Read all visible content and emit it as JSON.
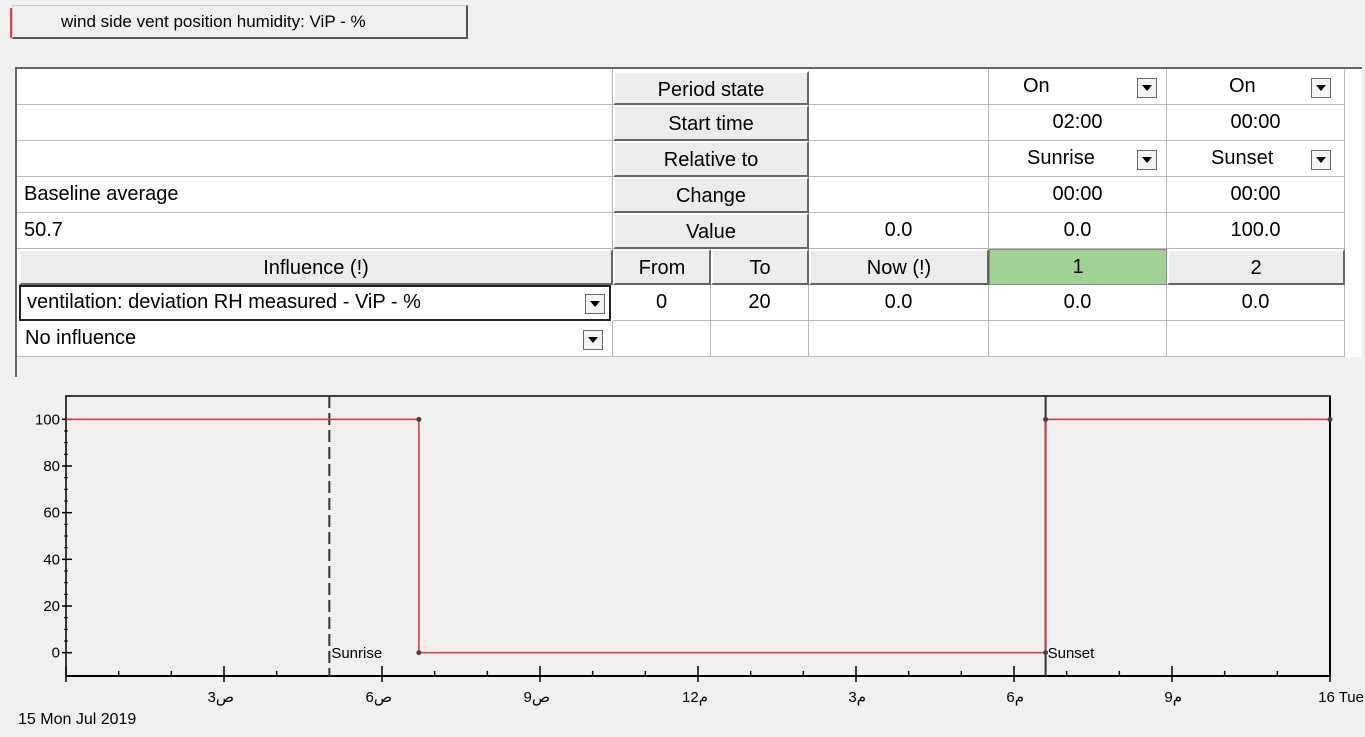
{
  "tab": {
    "label": "wind side vent position humidity: ViP - %"
  },
  "grid": {
    "rows": {
      "period_state": {
        "label": "Period state",
        "p1": "On",
        "p2": "On"
      },
      "start_time": {
        "label": "Start time",
        "p1": "02:00",
        "p2": "00:00"
      },
      "relative_to": {
        "label": "Relative to",
        "p1": "Sunrise",
        "p2": "Sunset"
      },
      "change": {
        "label": "Change",
        "left": "Baseline average",
        "p1": "00:00",
        "p2": "00:00"
      },
      "value": {
        "label": "Value",
        "left": "50.7",
        "now": "0.0",
        "p1": "0.0",
        "p2": "100.0"
      }
    },
    "header": {
      "influence": "Influence (!)",
      "from": "From",
      "to": "To",
      "now": "Now (!)",
      "p1": "1",
      "p2": "2"
    },
    "influences": [
      {
        "name": "ventilation: deviation RH measured - ViP - %",
        "from": "0",
        "to": "20",
        "now": "0.0",
        "p1": "0.0",
        "p2": "0.0"
      },
      {
        "name": "No influence",
        "from": "",
        "to": "",
        "now": "",
        "p1": "",
        "p2": ""
      }
    ]
  },
  "chart_data": {
    "type": "line",
    "y_ticks": [
      "100",
      "80",
      "60",
      "40",
      "20",
      "0"
    ],
    "ylim": [
      -10,
      110
    ],
    "x_ticks": [
      "3ص",
      "6ص",
      "9ص",
      "12م",
      "3م",
      "6م",
      "9م",
      "16 Tue"
    ],
    "date_label": "15 Mon Jul 2019",
    "markers": [
      {
        "label": "Sunrise",
        "style": "dashed"
      },
      {
        "label": "Sunset",
        "style": "solid"
      }
    ],
    "series": [
      {
        "color": "#e03030",
        "x_hours": [
          0,
          6.7,
          6.7,
          18.6,
          18.6,
          24
        ],
        "y": [
          100,
          100,
          0,
          0,
          100,
          100
        ]
      }
    ]
  }
}
